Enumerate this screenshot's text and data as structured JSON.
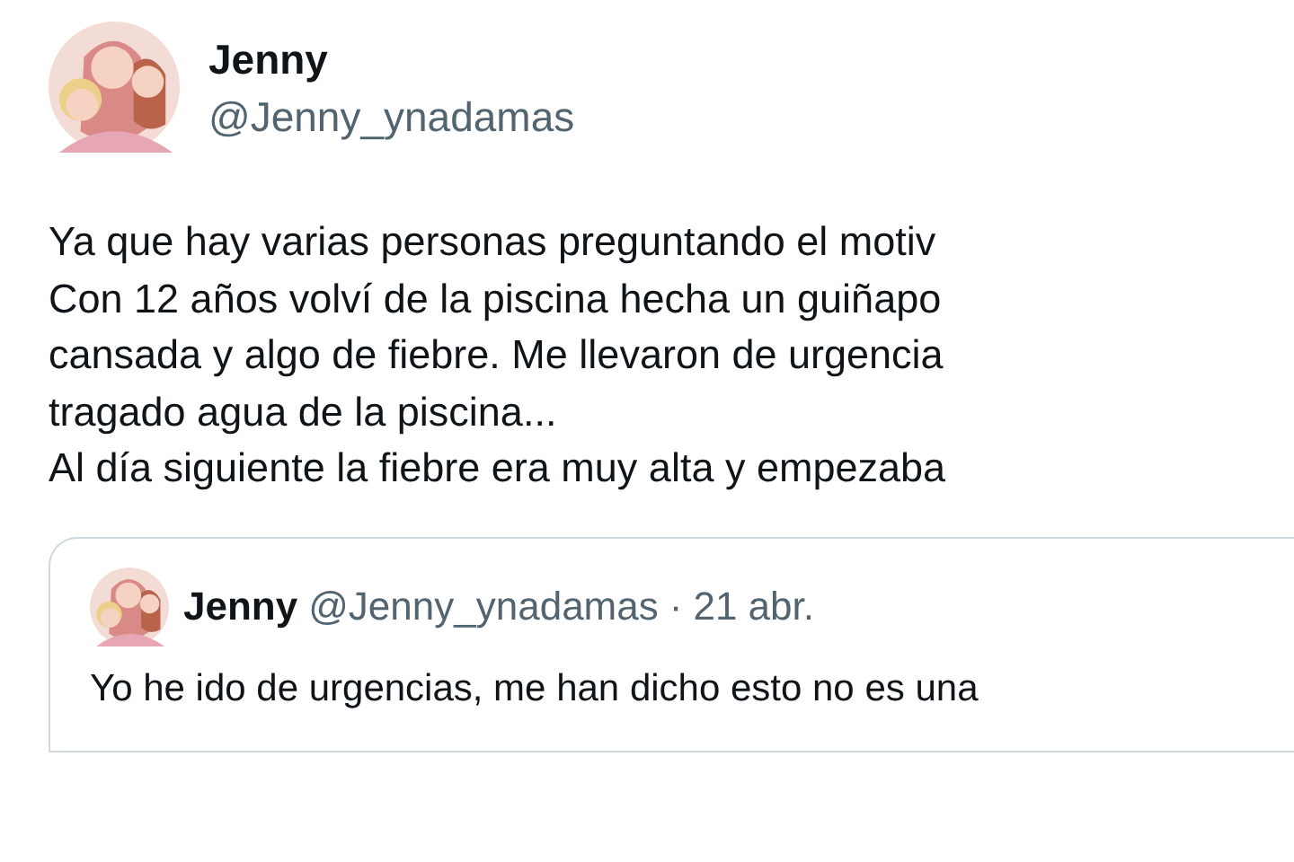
{
  "author": {
    "name": "Jenny",
    "handle": "@Jenny_ynadamas"
  },
  "text_lines": [
    "Ya que hay varias personas preguntando el motiv",
    "Con 12 años volví de la piscina hecha un guiñapo",
    "cansada y algo de fiebre. Me llevaron de urgencia",
    "tragado agua de la piscina...",
    "Al día siguiente la fiebre era muy alta y empezaba"
  ],
  "quote": {
    "name": "Jenny",
    "handle": "@Jenny_ynadamas",
    "separator": "·",
    "date": "21 abr.",
    "text_lines": [
      "Yo he ido de urgencias, me han dicho esto no es una"
    ]
  }
}
